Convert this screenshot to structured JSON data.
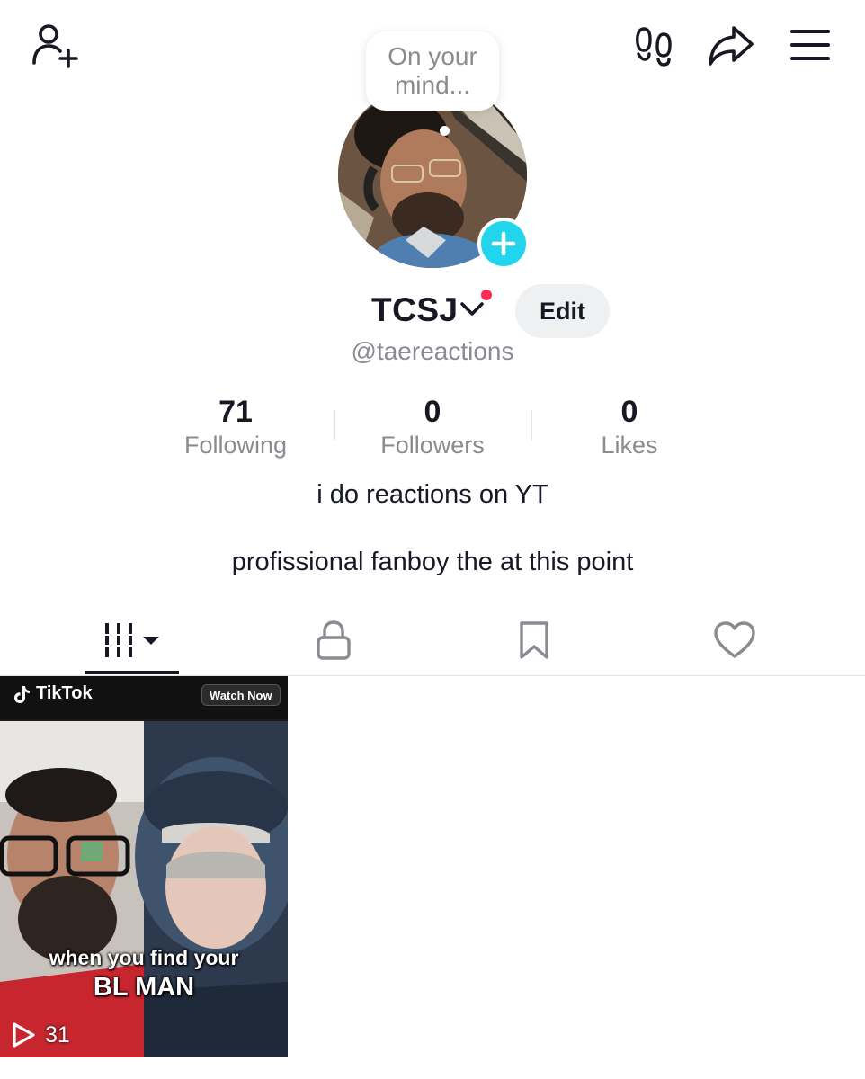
{
  "bubble": {
    "text": "On your mind..."
  },
  "profile": {
    "display_name": "TCSJ",
    "handle": "@taereactions",
    "edit_label": "Edit"
  },
  "stats": [
    {
      "value": "71",
      "label": "Following"
    },
    {
      "value": "0",
      "label": "Followers"
    },
    {
      "value": "0",
      "label": "Likes"
    }
  ],
  "bio": {
    "line1": "i do reactions on YT",
    "line2": "profissional fanboy the at this point"
  },
  "tabs": [
    {
      "icon": "videos-grid-icon",
      "active": true
    },
    {
      "icon": "lock-icon",
      "active": false
    },
    {
      "icon": "bookmark-icon",
      "active": false
    },
    {
      "icon": "heart-icon",
      "active": false
    }
  ],
  "video": {
    "brand": "TikTok",
    "watch_label": "Watch Now",
    "caption_line1": "when you find your",
    "caption_line2": "BL MAN",
    "views": "31"
  },
  "colors": {
    "accent_cyan": "#20d5ec",
    "notification_red": "#fe2c55",
    "text_primary": "#161823",
    "text_secondary": "#8a8b91"
  }
}
